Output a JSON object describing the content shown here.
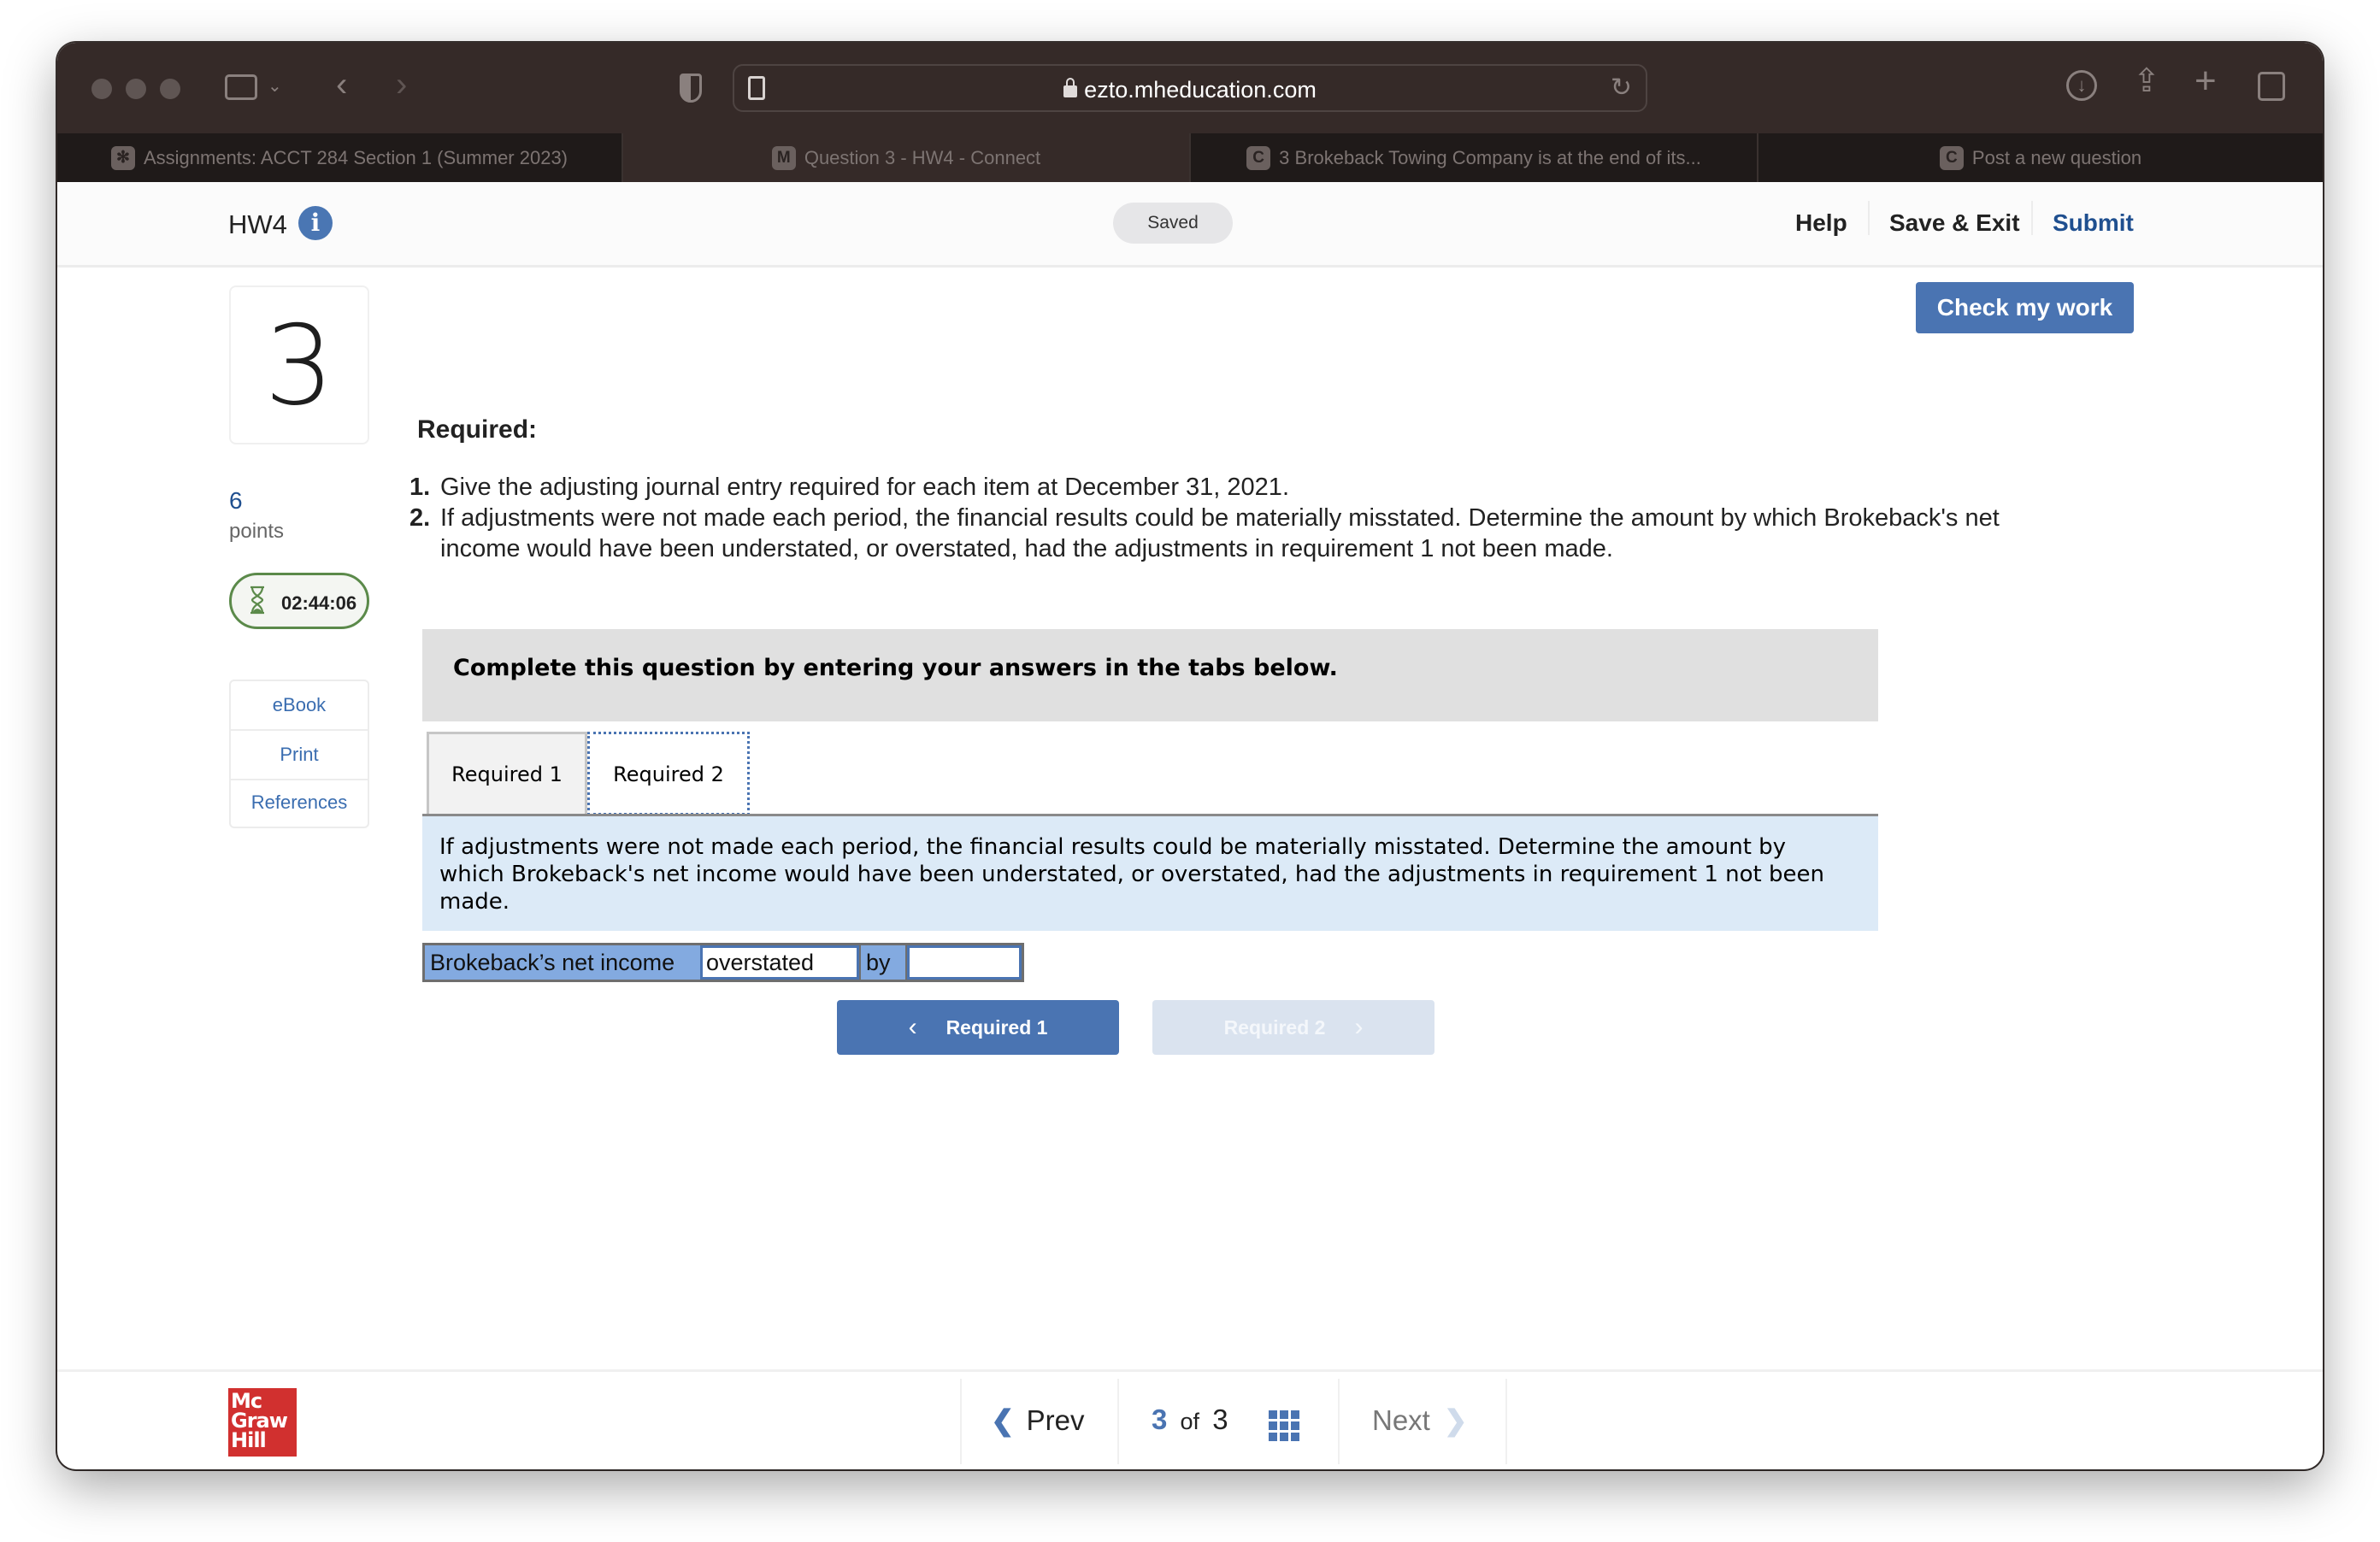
{
  "browser": {
    "url": "ezto.mheducation.com",
    "tabs": [
      {
        "favicon": "canvas-icon",
        "label": "Assignments: ACCT 284 Section 1 (Summer 2023)",
        "active": false
      },
      {
        "favicon": "M",
        "label": "Question 3 - HW4 - Connect",
        "active": true
      },
      {
        "favicon": "C",
        "label": "3 Brokeback Towing Company is at the end of its...",
        "active": false
      },
      {
        "favicon": "C",
        "label": "Post a new question",
        "active": false
      }
    ]
  },
  "header": {
    "title": "HW4",
    "info_icon": "i",
    "status": "Saved",
    "links": {
      "help": "Help",
      "save_exit": "Save & Exit",
      "submit": "Submit"
    }
  },
  "sidebar": {
    "question_number": "3",
    "points_value": "6",
    "points_label": "points",
    "timer": "02:44:06",
    "links": [
      "eBook",
      "Print",
      "References"
    ]
  },
  "main": {
    "check_button": "Check my work",
    "required_heading": "Required:",
    "requirements": [
      {
        "num": "1.",
        "text": "Give the adjusting journal entry required for each item at December 31, 2021."
      },
      {
        "num": "2.",
        "text": "If adjustments were not made each period, the financial results could be materially misstated. Determine the amount by which Brokeback's net income would have been understated, or overstated, had the adjustments in requirement 1 not been made."
      }
    ],
    "banner": "Complete this question by entering your answers in the tabs below.",
    "tabs": [
      {
        "label": "Required 1",
        "active": false
      },
      {
        "label": "Required 2",
        "active": true
      }
    ],
    "question_text": "If adjustments were not made each period, the financial results could be materially misstated. Determine the amount by which Brokeback's net income would have been understated, or overstated, had the adjustments in requirement 1 not been made.",
    "answer_row": {
      "label": "Brokeback’s net income",
      "direction_value": "overstated",
      "by_label": "by",
      "amount_value": ""
    },
    "nav": {
      "prev_label": "Required 1",
      "next_label": "Required 2"
    }
  },
  "footer": {
    "logo_lines": [
      "Mc",
      "Graw",
      "Hill"
    ],
    "prev": "Prev",
    "current": "3",
    "of": "of",
    "total": "3",
    "next": "Next"
  },
  "colors": {
    "accent": "#4a74b2",
    "submit": "#1f4f8f",
    "timer_border": "#5b8a4a",
    "logo": "#d1302f"
  }
}
